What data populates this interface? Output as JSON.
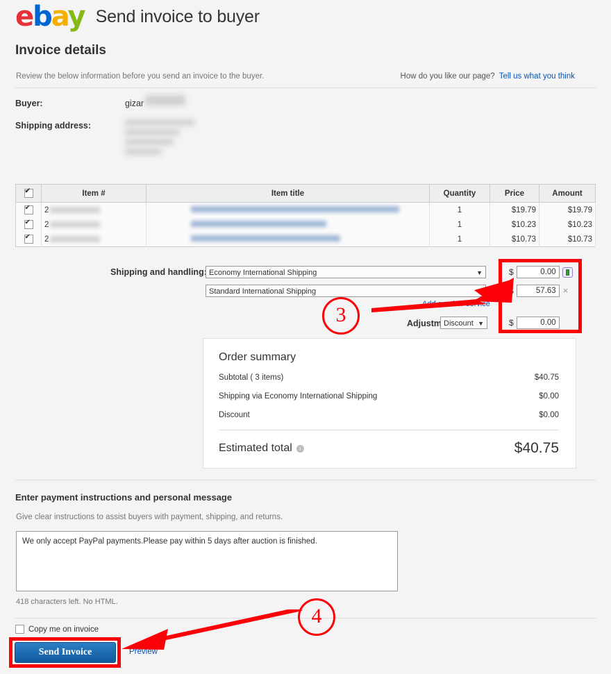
{
  "header": {
    "logo": "ebay",
    "title": "Send invoice to buyer"
  },
  "invoice": {
    "section_title": "Invoice details",
    "review_text": "Review the below information before you send an invoice to the buyer.",
    "feedback_question": "How do you like our page?",
    "feedback_link": "Tell us what you think"
  },
  "buyer": {
    "buyer_label": "Buyer:",
    "buyer_value": "gizar",
    "shipping_label": "Shipping address:"
  },
  "items_table": {
    "columns": [
      "Item #",
      "Item title",
      "Quantity",
      "Price",
      "Amount"
    ],
    "rows": [
      {
        "item_num_prefix": "2",
        "quantity": "1",
        "price": "$19.79",
        "amount": "$19.79"
      },
      {
        "item_num_prefix": "2",
        "quantity": "1",
        "price": "$10.23",
        "amount": "$10.23"
      },
      {
        "item_num_prefix": "2",
        "quantity": "1",
        "price": "$10.73",
        "amount": "$10.73"
      }
    ]
  },
  "shipping": {
    "label": "Shipping and handling:",
    "service_1": "Economy International Shipping",
    "service_2": "Standard International Shipping",
    "add_service_link": "Add another service",
    "adjustment_label": "Adjustment:",
    "adjustment_value": "Discount",
    "currency_symbol": "$",
    "amount_1": "0.00",
    "amount_2": "57.63",
    "amount_adjustment": "0.00",
    "remove_symbol": "×"
  },
  "order_summary": {
    "title": "Order summary",
    "rows": [
      {
        "label": "Subtotal ( 3 items)",
        "value": "$40.75"
      },
      {
        "label": "Shipping via Economy International Shipping",
        "value": "$0.00"
      },
      {
        "label": "Discount",
        "value": "$0.00"
      }
    ],
    "total_label": "Estimated total",
    "total_value": "$40.75"
  },
  "message": {
    "title": "Enter payment instructions and personal message",
    "subtitle": "Give clear instructions to assist buyers with payment, shipping, and returns.",
    "text": "We only accept PayPal payments.Please pay within 5 days after auction is finished.",
    "chars_left": "418 characters left. No HTML."
  },
  "footer": {
    "copy_label": "Copy me on invoice",
    "send_button": "Send Invoice",
    "preview_link": "Preview"
  },
  "annotations": {
    "step_3": "3",
    "step_4": "4",
    "highlight_color": "#fb0007"
  }
}
